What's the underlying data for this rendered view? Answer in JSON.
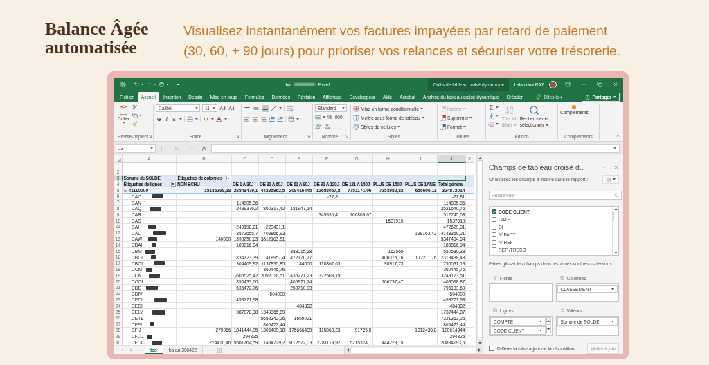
{
  "header": {
    "title_lines": [
      "Balance Âgée",
      "automatisée"
    ],
    "tagline_lines": [
      "Visualisez instantanément vos factures impayées par retard de paiement",
      "(30, 60, + 90 jours) pour prioriser vos relances et sécuriser votre trésorerie."
    ]
  },
  "title_bar": {
    "file_name": "ba",
    "app_name": "Excel",
    "context_label": "Outils de tableau croisé dynamique",
    "user_name": "Lalanirina RAZ"
  },
  "tabs": [
    {
      "label": "Fichier",
      "selected": false
    },
    {
      "label": "Accueil",
      "selected": true
    },
    {
      "label": "Insertion",
      "selected": false
    },
    {
      "label": "Dessin",
      "selected": false
    },
    {
      "label": "Mise en page",
      "selected": false
    },
    {
      "label": "Formules",
      "selected": false
    },
    {
      "label": "Données",
      "selected": false
    },
    {
      "label": "Révision",
      "selected": false
    },
    {
      "label": "Affichage",
      "selected": false
    },
    {
      "label": "Développeur",
      "selected": false
    },
    {
      "label": "Aide",
      "selected": false
    },
    {
      "label": "Acrobat",
      "selected": false
    },
    {
      "label": "Analyse du tableau croisé dynamique",
      "selected": false
    },
    {
      "label": "Création",
      "selected": false
    }
  ],
  "tell_me": {
    "placeholder": "Dites-le-r"
  },
  "share_button": {
    "label": "Partager"
  },
  "ribbon": {
    "groups": [
      {
        "kind": "clipboard",
        "label": "Presse-papiers",
        "paste_label": "Coller"
      },
      {
        "kind": "font",
        "label": "Police",
        "font_name": "Calibri",
        "font_size": "11",
        "style_buttons": [
          {
            "kind": "bold",
            "label": "G"
          },
          {
            "kind": "italic",
            "label": "I"
          },
          {
            "kind": "underline",
            "label": "S"
          }
        ]
      },
      {
        "kind": "alignment",
        "label": "Alignement",
        "vertical_align_buttons": [
          {
            "kind": "top",
            "selected": false
          },
          {
            "kind": "middle",
            "selected": false
          },
          {
            "kind": "bottom",
            "selected": true
          }
        ]
      },
      {
        "kind": "number",
        "label": "Nombre",
        "format": "Standard",
        "percent_label": "%",
        "thousands_label": "000"
      },
      {
        "kind": "styles",
        "label": "Styles",
        "buttons": [
          {
            "kind": "conditional",
            "label": "Mise en forme conditionnelle"
          },
          {
            "kind": "table",
            "label": "Mettre sous forme de tableau"
          },
          {
            "kind": "cell_styles",
            "label": "Styles de cellules"
          }
        ]
      },
      {
        "kind": "cells",
        "label": "Cellules",
        "buttons": [
          {
            "kind": "insert",
            "label": "Insérer",
            "disabled": true
          },
          {
            "kind": "delete",
            "label": "Supprimer",
            "disabled": false
          },
          {
            "kind": "format",
            "label": "Format",
            "disabled": false
          }
        ]
      },
      {
        "kind": "editing",
        "label": "Édition",
        "sort_button": {
          "label_lines": [
            "Trier et",
            "filtrer"
          ],
          "disabled": true
        },
        "find_button": {
          "label_lines": [
            "Rechercher et",
            "sélectionner"
          ],
          "disabled": false
        }
      },
      {
        "kind": "addins",
        "label": "Compléments",
        "button_label": "Compléments"
      }
    ]
  },
  "formula_bar": {
    "name_box": "J3",
    "function_label": "fx"
  },
  "sheet": {
    "columns": [
      {
        "label": "A",
        "selected": false
      },
      {
        "label": "B",
        "selected": false
      },
      {
        "label": "C",
        "selected": false
      },
      {
        "label": "D",
        "selected": false
      },
      {
        "label": "E",
        "selected": false
      },
      {
        "label": "F",
        "selected": false
      },
      {
        "label": "G",
        "selected": false
      },
      {
        "label": "H",
        "selected": false
      },
      {
        "label": "I",
        "selected": false
      },
      {
        "label": "J",
        "selected": true
      },
      {
        "label": "K",
        "selected": false
      }
    ],
    "rows": [
      {
        "number": "1",
        "selected": false,
        "kind": "blank"
      },
      {
        "number": "2",
        "selected": false,
        "kind": "blank"
      },
      {
        "number": "3",
        "selected": true,
        "kind": "pivot_corner",
        "value_field": "Somme de SOLDE",
        "column_labels": "Étiquettes de colonnes"
      },
      {
        "number": "4",
        "selected": false,
        "kind": "pivot_columns",
        "row_labels": "Étiquettes de lignes",
        "cells": [
          "NON ECHU",
          "DE 1 A 30J",
          "DE 31 A 60J",
          "DE 61 A 90J",
          "DE 91 A 120J",
          "DE 121 A 150J",
          "PLUS DE 150J",
          "PLUS DE 1ANS",
          "Total général"
        ]
      },
      {
        "number": "5",
        "selected": false,
        "kind": "group",
        "label": "41110000",
        "expanded": true,
        "cells": [
          "15186299,18",
          "28843479,1",
          "44295962,5",
          "208416445",
          "12688067,8",
          "7751171,06",
          "7253982,82",
          "656606,11",
          "324872014"
        ]
      },
      {
        "number": "6",
        "selected": false,
        "kind": "item",
        "label": "CAC",
        "redacted": true,
        "cells": [
          null,
          null,
          null,
          null,
          "-27,81",
          null,
          null,
          null,
          "-27,81"
        ]
      },
      {
        "number": "7",
        "selected": false,
        "kind": "item",
        "label": "CAN",
        "redacted": false,
        "cells": [
          null,
          "114805,36",
          null,
          null,
          null,
          null,
          null,
          null,
          "114805,36"
        ]
      },
      {
        "number": "8",
        "selected": false,
        "kind": "item",
        "label": "CAQ",
        "redacted": true,
        "cells": [
          null,
          "2489376,2",
          "860317,42",
          "181947,14",
          null,
          null,
          null,
          null,
          "3531640,76"
        ]
      },
      {
        "number": "9",
        "selected": false,
        "kind": "item",
        "label": "CAR",
        "redacted": false,
        "cells": [
          null,
          null,
          null,
          null,
          "345935,41",
          "166809,67",
          null,
          null,
          "512745,08"
        ]
      },
      {
        "number": "10",
        "selected": false,
        "kind": "item",
        "label": "CAS",
        "redacted": false,
        "cells": [
          null,
          null,
          null,
          null,
          null,
          null,
          "1537919",
          null,
          "1537919"
        ]
      },
      {
        "number": "11",
        "selected": false,
        "kind": "item",
        "label": "CAI",
        "redacted": true,
        "cells": [
          null,
          "249198,21",
          "223431,1",
          null,
          null,
          null,
          null,
          null,
          "472629,31"
        ]
      },
      {
        "number": "12",
        "selected": false,
        "kind": "item",
        "label": "CAL",
        "redacted": true,
        "cells": [
          null,
          "3572655,7",
          "708866,93",
          null,
          null,
          null,
          null,
          "-138163,42",
          "4143359,21"
        ]
      },
      {
        "number": "13",
        "selected": false,
        "kind": "item",
        "label": "CAW",
        "redacted": true,
        "cells": [
          "140000",
          "1395290,63",
          "3812163,91",
          null,
          null,
          null,
          null,
          null,
          "5347454,54"
        ]
      },
      {
        "number": "14",
        "selected": false,
        "kind": "item",
        "label": "CBAI",
        "redacted": true,
        "cells": [
          null,
          "189816,94",
          null,
          null,
          null,
          null,
          null,
          null,
          "189816,94"
        ]
      },
      {
        "number": "15",
        "selected": false,
        "kind": "item",
        "label": "CBM",
        "redacted": true,
        "cells": [
          null,
          null,
          null,
          "388015,38",
          null,
          null,
          "162565",
          null,
          "550580,38"
        ]
      },
      {
        "number": "16",
        "selected": false,
        "kind": "item",
        "label": "CBOL",
        "redacted": true,
        "cells": [
          null,
          "834723,39",
          "418957,4",
          "472170,77",
          null,
          null,
          "400375,16",
          "172211,76",
          "2318438,48"
        ]
      },
      {
        "number": "17",
        "selected": false,
        "kind": "item",
        "label": "CBOL",
        "redacted": true,
        "cells": [
          null,
          "304409,92",
          "1137835,85",
          "144000",
          "110867,63",
          null,
          "98917,73",
          null,
          "1796031,13"
        ]
      },
      {
        "number": "18",
        "selected": false,
        "kind": "item",
        "label": "CCM",
        "redacted": true,
        "cells": [
          null,
          null,
          "360445,76",
          null,
          null,
          null,
          null,
          null,
          "360445,76"
        ]
      },
      {
        "number": "19",
        "selected": false,
        "kind": "item",
        "label": "CCN",
        "redacted": true,
        "cells": [
          null,
          "-606625,42",
          "2092018,51",
          "1435271,23",
          "322509,19",
          null,
          null,
          null,
          "3243173,51"
        ]
      },
      {
        "number": "20",
        "selected": false,
        "kind": "item",
        "label": "CCOL",
        "redacted": false,
        "cells": [
          null,
          "890433,66",
          null,
          "405927,74",
          null,
          null,
          "106737,47",
          null,
          "1403098,87"
        ]
      },
      {
        "number": "21",
        "selected": false,
        "kind": "item",
        "label": "CDD",
        "redacted": true,
        "cells": [
          null,
          "536472,76",
          null,
          "259710,93",
          null,
          null,
          null,
          null,
          "796183,69"
        ]
      },
      {
        "number": "22",
        "selected": false,
        "kind": "item",
        "label": "CDIV",
        "redacted": false,
        "cells": [
          null,
          null,
          "-504000",
          null,
          null,
          null,
          null,
          null,
          "-504000"
        ]
      },
      {
        "number": "23",
        "selected": false,
        "kind": "item",
        "label": "CEDI",
        "redacted": true,
        "cells": [
          null,
          "493771,98",
          null,
          null,
          null,
          null,
          null,
          null,
          "493771,98"
        ]
      },
      {
        "number": "24",
        "selected": false,
        "kind": "item",
        "label": "CEDI",
        "redacted": false,
        "cells": [
          null,
          null,
          null,
          "484382",
          null,
          null,
          null,
          null,
          "484382"
        ]
      },
      {
        "number": "25",
        "selected": false,
        "kind": "item",
        "label": "CELY",
        "redacted": true,
        "cells": [
          null,
          "387878,98",
          "1349365,89",
          null,
          null,
          null,
          null,
          null,
          "1737444,87"
        ]
      },
      {
        "number": "26",
        "selected": false,
        "kind": "item",
        "label": "CETE",
        "redacted": false,
        "cells": [
          null,
          null,
          "5652342,26",
          "1669021",
          null,
          null,
          null,
          null,
          "7321363,26"
        ]
      },
      {
        "number": "27",
        "selected": false,
        "kind": "item",
        "label": "CFEL",
        "redacted": true,
        "cells": [
          null,
          null,
          "865423,44",
          null,
          null,
          null,
          null,
          null,
          "865423,44"
        ]
      },
      {
        "number": "28",
        "selected": false,
        "kind": "item",
        "label": "CFIJ",
        "redacted": false,
        "cells": [
          "279966",
          "1841444,95",
          "1306409,18",
          "175666499",
          "115860,23",
          "91725,5",
          null,
          "1312438,8",
          "180614344"
        ]
      },
      {
        "number": "29",
        "selected": false,
        "kind": "item",
        "label": "CFLC",
        "redacted": true,
        "cells": [
          null,
          "394825",
          null,
          null,
          null,
          null,
          null,
          null,
          "394825"
        ]
      },
      {
        "number": "30",
        "selected": false,
        "kind": "item",
        "label": "CFOC",
        "redacted": true,
        "cells": [
          "1224410,46",
          "5561764,59",
          "1494729,2",
          "3112622,03",
          "2781119,92",
          "6215324,1",
          "444223,15",
          null,
          "20834193,5"
        ]
      }
    ]
  },
  "sheet_tabs": [
    {
      "label": "tcd",
      "selected": true
    },
    {
      "label": "ba au 300422",
      "selected": false
    }
  ],
  "pivot_panel": {
    "title": "Champs de tableau croisé d..",
    "instruction": "Choisissez les champs à inclure dans le rapport :",
    "search": {
      "placeholder": "Rechercher"
    },
    "fields": [
      {
        "label": "CODE CLIENT",
        "checked": true
      },
      {
        "label": "DATE",
        "checked": false
      },
      {
        "label": "CI",
        "checked": false
      },
      {
        "label": "N°FACT",
        "checked": false
      },
      {
        "label": "N°REF",
        "checked": false
      },
      {
        "label": "REF /TRESO",
        "checked": false
      }
    ],
    "drag_hint": "Faites glisser les champs dans les zones voulues ci-dessous :",
    "areas": [
      {
        "kind": "filters",
        "label": "Filtres",
        "scroll_arrows": false
      },
      {
        "kind": "columns",
        "label": "Colonnes",
        "scroll_arrows": false,
        "items": [
          "CLASSEMENT"
        ]
      },
      {
        "kind": "rows",
        "label": "Lignes",
        "scroll_arrows": true,
        "items": [
          "COMPTE",
          "CODE CLIENT"
        ]
      },
      {
        "kind": "values",
        "label": "Valeurs",
        "scroll_arrows": false,
        "items": [
          "Somme de SOLDE"
        ]
      }
    ],
    "defer_update": {
      "label": "Différer la mise à jour de la disposition",
      "checked": false
    },
    "update_button": {
      "label": "Mettre à jour",
      "disabled": true
    }
  }
}
